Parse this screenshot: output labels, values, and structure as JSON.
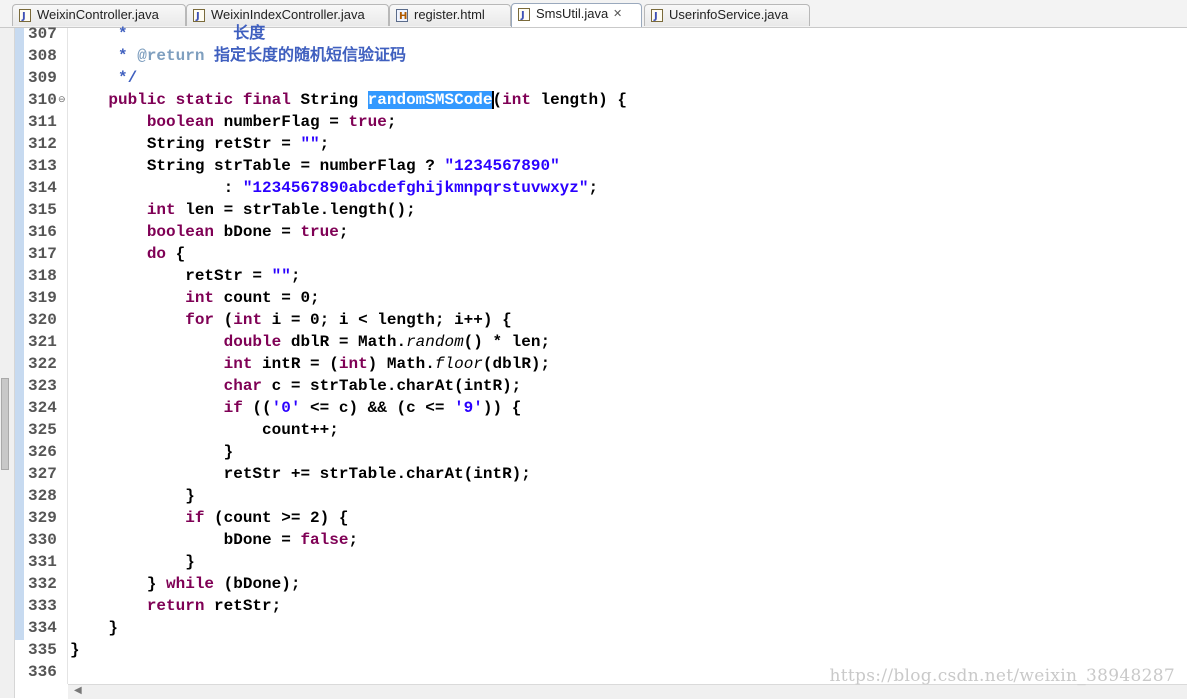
{
  "tabs": [
    {
      "label": "WeixinController.java",
      "icon": "java-file-icon",
      "active": false
    },
    {
      "label": "WeixinIndexController.java",
      "icon": "java-file-icon",
      "active": false
    },
    {
      "label": "register.html",
      "icon": "html-file-icon",
      "active": false
    },
    {
      "label": "SmsUtil.java",
      "icon": "java-file-icon",
      "active": true,
      "close": "✕"
    },
    {
      "label": "UserinfoService.java",
      "icon": "java-interface-icon",
      "active": false
    }
  ],
  "editor": {
    "line_numbers": [
      "307",
      "308",
      "309",
      "310",
      "311",
      "312",
      "313",
      "314",
      "315",
      "316",
      "317",
      "318",
      "319",
      "320",
      "321",
      "322",
      "323",
      "324",
      "325",
      "326",
      "327",
      "328",
      "329",
      "330",
      "331",
      "332",
      "333",
      "334",
      "335",
      "336"
    ],
    "selected_text": "randomSMSCode",
    "tokens": {
      "l307": "     *           长度",
      "l308_star": "     * ",
      "l308_tag": "@return",
      "l308_text": " 指定长度的随机短信验证码",
      "l309": "     */",
      "l310_pub": "public",
      "l310_static": "static",
      "l310_final": "final",
      "l310_string": " String ",
      "l310_paren": "(",
      "l310_int": "int",
      "l310_rest": " length) {",
      "l311_kw": "boolean",
      "l311_mid": " numberFlag = ",
      "l311_val": "true",
      "l311_end": ";",
      "l312_a": "String retStr = ",
      "l312_str": "\"\"",
      "l312_end": ";",
      "l313_a": "String strTable = numberFlag ? ",
      "l313_str": "\"1234567890\"",
      "l314_a": ": ",
      "l314_str": "\"1234567890abcdefghijkmnpqrstuvwxyz\"",
      "l314_end": ";",
      "l315_kw": "int",
      "l315_rest": " len = strTable.length();",
      "l316_kw": "boolean",
      "l316_mid": " bDone = ",
      "l316_val": "true",
      "l316_end": ";",
      "l317_kw": "do",
      "l317_rest": " {",
      "l318_a": "retStr = ",
      "l318_str": "\"\"",
      "l318_end": ";",
      "l319_kw": "int",
      "l319_rest": " count = 0;",
      "l320_kw": "for",
      "l320_a": " (",
      "l320_int": "int",
      "l320_rest": " i = 0; i < length; i++) {",
      "l321_kw": "double",
      "l321_a": " dblR = Math.",
      "l321_it": "random",
      "l321_rest": "() * len;",
      "l322_kw": "int",
      "l322_a": " intR = (",
      "l322_int": "int",
      "l322_b": ") Math.",
      "l322_it": "floor",
      "l322_rest": "(dblR);",
      "l323_kw": "char",
      "l323_rest": " c = strTable.charAt(intR);",
      "l324_kw": "if",
      "l324_a": " ((",
      "l324_s1": "'0'",
      "l324_b": " <= c) && (c <= ",
      "l324_s2": "'9'",
      "l324_rest": ")) {",
      "l325": "count++;",
      "l326": "}",
      "l327": "retStr += strTable.charAt(intR);",
      "l328": "}",
      "l329_kw": "if",
      "l329_rest": " (count >= 2) {",
      "l330_a": "bDone = ",
      "l330_val": "false",
      "l330_end": ";",
      "l331": "}",
      "l332_a": "} ",
      "l332_kw": "while",
      "l332_rest": " (bDone);",
      "l333_kw": "return",
      "l333_rest": " retStr;",
      "l334": "}",
      "l335": "}"
    }
  },
  "watermark": "https://blog.csdn.net/weixin_38948287",
  "colors": {
    "keyword": "#7f0055",
    "string": "#2a00ff",
    "javadoc": "#3f5fbf",
    "selection": "#3399ff"
  }
}
